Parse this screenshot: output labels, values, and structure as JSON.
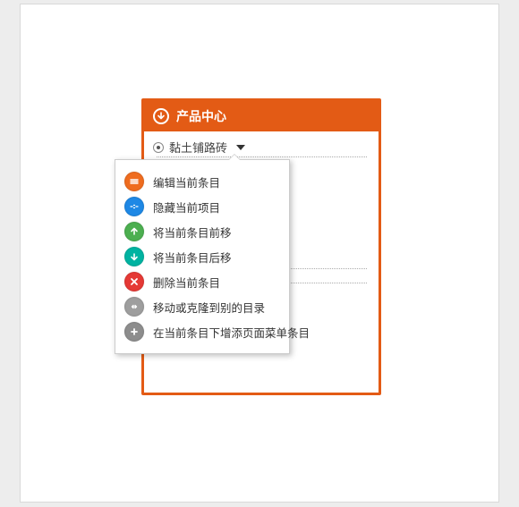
{
  "panel": {
    "title": "产品中心",
    "current_item": "黏土铺路砖"
  },
  "menu": {
    "items": [
      {
        "icon": "edit",
        "color": "orange",
        "label": "编辑当前条目"
      },
      {
        "icon": "hide",
        "color": "blue",
        "label": "隐藏当前项目"
      },
      {
        "icon": "arrow-up",
        "color": "green",
        "label": "将当前条目前移"
      },
      {
        "icon": "arrow-down",
        "color": "teal",
        "label": "将当前条目后移"
      },
      {
        "icon": "delete",
        "color": "red",
        "label": "删除当前条目"
      },
      {
        "icon": "move",
        "color": "grey",
        "label": "移动或克隆到别的目录"
      },
      {
        "icon": "add",
        "color": "grey2",
        "label": "在当前条目下增添页面菜单条目"
      }
    ]
  }
}
